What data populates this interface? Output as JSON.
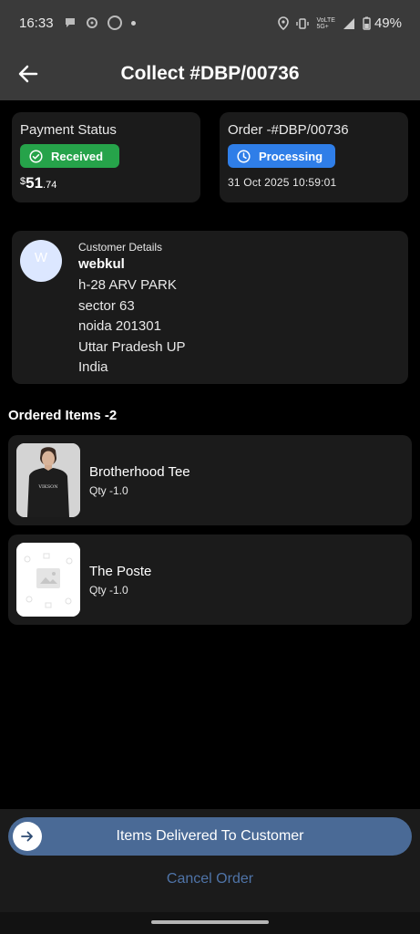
{
  "status_bar": {
    "time": "16:33",
    "battery": "49%",
    "network_top": "VoLTE",
    "network_bottom": "5G+"
  },
  "header": {
    "title": "Collect #DBP/00736"
  },
  "payment": {
    "label": "Payment Status",
    "status": "Received",
    "currency": "$",
    "amount_main": "51",
    "amount_cents": ".74"
  },
  "order": {
    "label": "Order -#DBP/00736",
    "status": "Processing",
    "date": "31 Oct 2025 10:59:01"
  },
  "customer": {
    "avatar_letter": "W",
    "title": "Customer Details",
    "name": "webkul",
    "address_line1": "h-28 ARV PARK",
    "address_line2": "sector 63",
    "address_line3": "noida 201301",
    "address_line4": "Uttar Pradesh UP",
    "address_line5": "India"
  },
  "items_section": {
    "title": "Ordered Items -2"
  },
  "items": [
    {
      "name": "Brotherhood Tee",
      "qty": "Qty  -1.0"
    },
    {
      "name": "The Poste",
      "qty": "Qty  -1.0"
    }
  ],
  "actions": {
    "deliver_label": "Items Delivered To Customer",
    "cancel_label": "Cancel Order"
  },
  "colors": {
    "received_badge": "#26a34a",
    "processing_badge": "#2f7ee8",
    "primary_button": "#4a6a96",
    "cancel_text": "#4f74a8"
  }
}
